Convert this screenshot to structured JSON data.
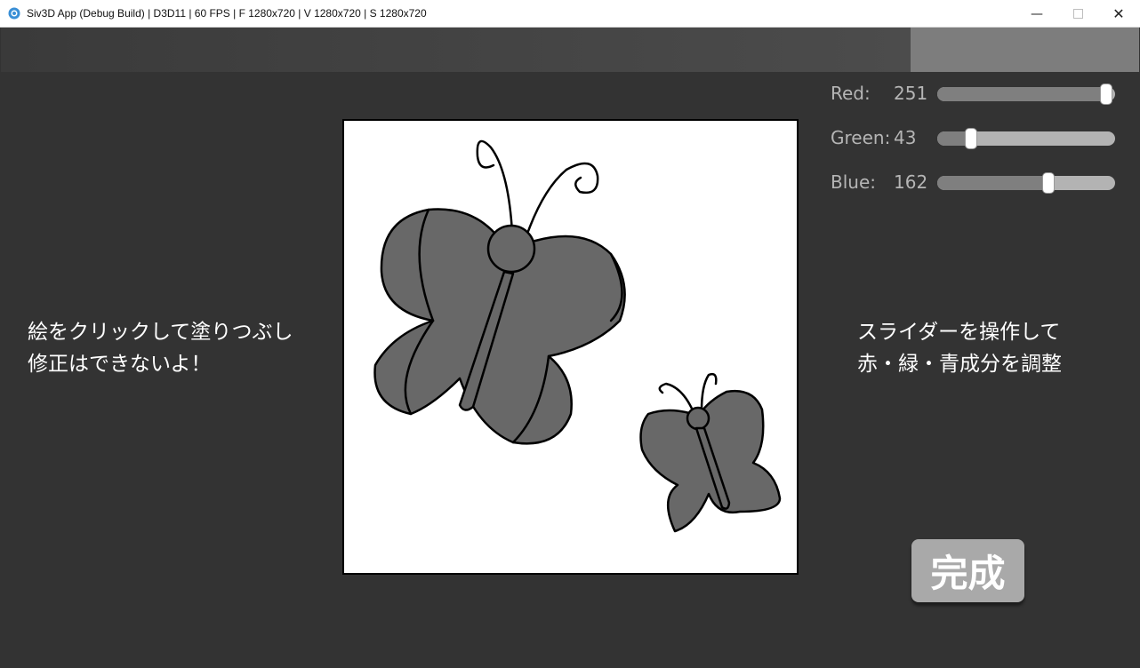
{
  "window": {
    "title": "Siv3D App (Debug Build) | D3D11 | 60 FPS | F 1280x720 | V 1280x720 | S 1280x720",
    "icon": "siv3d-icon",
    "controls": {
      "minimize": "—",
      "close": "✕"
    }
  },
  "color_swatch": {
    "color": "#7d7d7d"
  },
  "sliders": [
    {
      "label": "Red:",
      "value": "251",
      "level": 251,
      "max": 255
    },
    {
      "label": "Green:",
      "value": "43",
      "level": 43,
      "max": 255
    },
    {
      "label": "Blue:",
      "value": "162",
      "level": 162,
      "max": 255
    }
  ],
  "left_instruction": {
    "line1": "絵をクリックして塗りつぶし",
    "line2": "修正はできないよ！"
  },
  "right_instruction": {
    "line1": "スライダーを操作して",
    "line2": "赤・緑・青成分を調整"
  },
  "done_button": {
    "label": "完成"
  },
  "colors": {
    "background": "#333333",
    "fill_gray": "#686868",
    "button": "#a9a9a9"
  }
}
